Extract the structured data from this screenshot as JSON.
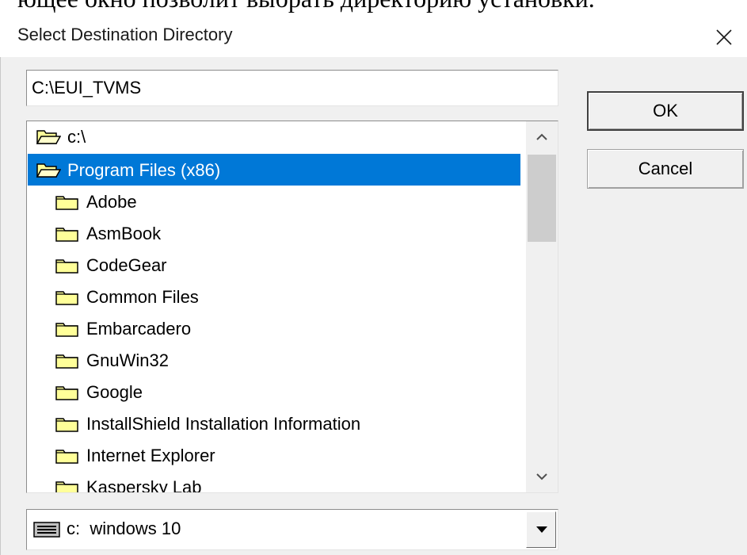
{
  "document_fragment": {
    "text": "ющее окно позволит выбрать директорию установки."
  },
  "dialog": {
    "title": "Select Destination Directory",
    "path_input": {
      "value": "C:\\EUI_TVMS"
    },
    "buttons": {
      "ok_label": "OK",
      "cancel_label": "Cancel"
    },
    "tree": {
      "items": [
        {
          "label": "c:\\",
          "icon": "open-folder-icon",
          "selected": false
        },
        {
          "label": "Program Files (x86)",
          "icon": "open-folder-icon",
          "selected": true
        },
        {
          "label": "Adobe",
          "icon": "folder-icon",
          "selected": false
        },
        {
          "label": "AsmBook",
          "icon": "folder-icon",
          "selected": false
        },
        {
          "label": "CodeGear",
          "icon": "folder-icon",
          "selected": false
        },
        {
          "label": "Common Files",
          "icon": "folder-icon",
          "selected": false
        },
        {
          "label": "Embarcadero",
          "icon": "folder-icon",
          "selected": false
        },
        {
          "label": "GnuWin32",
          "icon": "folder-icon",
          "selected": false
        },
        {
          "label": "Google",
          "icon": "folder-icon",
          "selected": false
        },
        {
          "label": "InstallShield Installation Information",
          "icon": "folder-icon",
          "selected": false
        },
        {
          "label": "Internet Explorer",
          "icon": "folder-icon",
          "selected": false
        },
        {
          "label": "Kaspersky Lab",
          "icon": "folder-icon",
          "selected": false
        }
      ]
    },
    "drive": {
      "letter": "c:",
      "name": "windows 10",
      "icon": "drive-icon"
    },
    "colors": {
      "selection": "#0078d7",
      "folder_fill": "#ffff99",
      "dialog_bg": "#f0f0f0"
    }
  }
}
